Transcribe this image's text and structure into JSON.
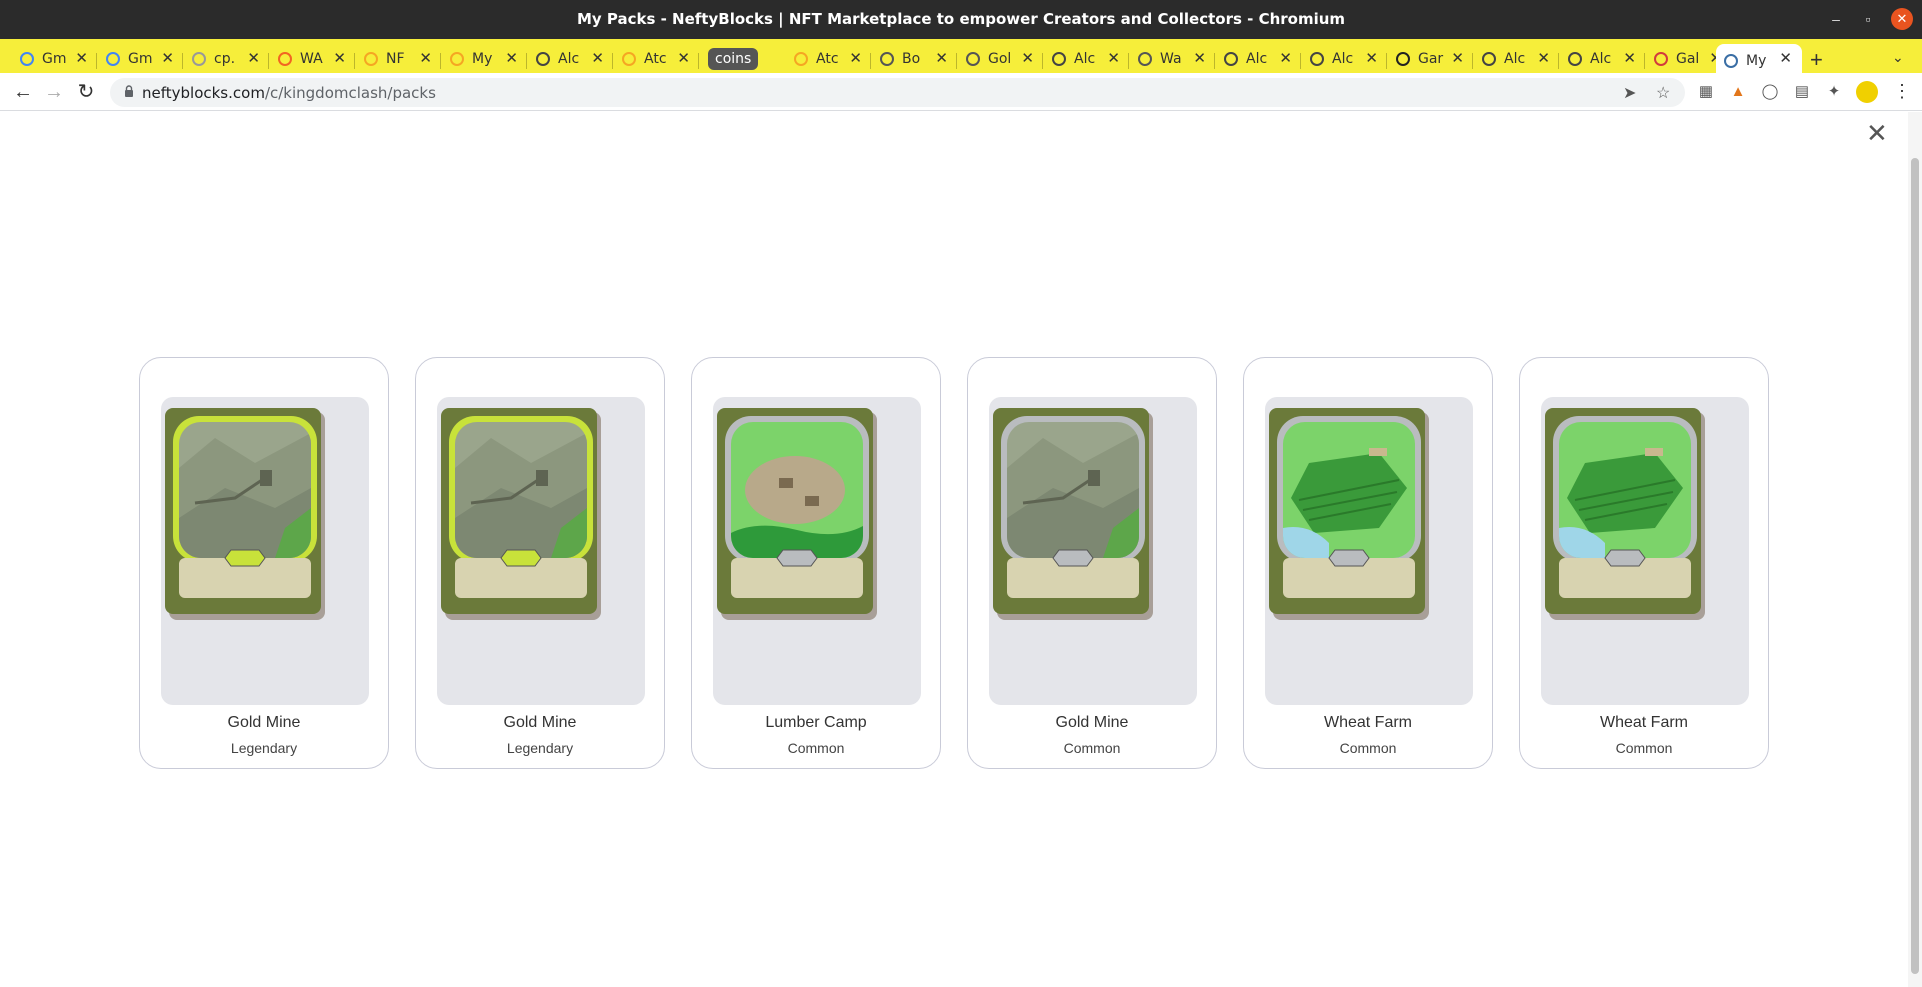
{
  "window": {
    "title": "My Packs - NeftyBlocks | NFT Marketplace to empower Creators and Collectors - Chromium"
  },
  "tabs": [
    {
      "label": "Gm",
      "icon": "google-icon",
      "color": "#4285f4"
    },
    {
      "label": "Gm",
      "icon": "google-icon",
      "color": "#4285f4"
    },
    {
      "label": "cp.",
      "icon": "loading-icon",
      "color": "#999999"
    },
    {
      "label": "WA",
      "icon": "wax-icon",
      "color": "#f26522"
    },
    {
      "label": "NF",
      "icon": "sun-icon",
      "color": "#f5a623"
    },
    {
      "label": "My",
      "icon": "sun-icon",
      "color": "#f5a623"
    },
    {
      "label": "Alc",
      "icon": "drop-icon",
      "color": "#444444"
    },
    {
      "label": "Atc",
      "icon": "sun-icon",
      "color": "#f5a623"
    },
    {
      "label": "Atc",
      "icon": "sun-icon",
      "color": "#f5a623"
    },
    {
      "label": "Bo",
      "icon": "globe-icon",
      "color": "#555555"
    },
    {
      "label": "Gol",
      "icon": "globe-icon",
      "color": "#555555"
    },
    {
      "label": "Alc",
      "icon": "drop-icon",
      "color": "#444444"
    },
    {
      "label": "Wa",
      "icon": "globe-icon",
      "color": "#555555"
    },
    {
      "label": "Alc",
      "icon": "drop-icon",
      "color": "#444444"
    },
    {
      "label": "Alc",
      "icon": "drop-icon",
      "color": "#444444"
    },
    {
      "label": "Gar",
      "icon": "game-icon",
      "color": "#222222"
    },
    {
      "label": "Alc",
      "icon": "drop-icon",
      "color": "#444444"
    },
    {
      "label": "Alc",
      "icon": "drop-icon",
      "color": "#444444"
    },
    {
      "label": "Gal",
      "icon": "flag-icon",
      "color": "#d23c3c"
    },
    {
      "label": "My",
      "icon": "cube-icon",
      "color": "#3a6ea5"
    }
  ],
  "tab_group": {
    "label": "coins"
  },
  "address": {
    "host": "neftyblocks.com",
    "path": "/c/kingdomclash/packs"
  },
  "cards": [
    {
      "name": "Gold Mine",
      "rarity": "Legendary",
      "art": "gold-mine",
      "frame": "legendary"
    },
    {
      "name": "Gold Mine",
      "rarity": "Legendary",
      "art": "gold-mine",
      "frame": "legendary"
    },
    {
      "name": "Lumber Camp",
      "rarity": "Common",
      "art": "lumber-camp",
      "frame": "common"
    },
    {
      "name": "Gold Mine",
      "rarity": "Common",
      "art": "gold-mine",
      "frame": "common"
    },
    {
      "name": "Wheat Farm",
      "rarity": "Common",
      "art": "wheat-farm",
      "frame": "common"
    },
    {
      "name": "Wheat Farm",
      "rarity": "Common",
      "art": "wheat-farm",
      "frame": "common"
    }
  ],
  "colors": {
    "tabstrip": "#f6ee3a",
    "legendary_frame": "#c8e23a",
    "common_frame": "#b9bcbf"
  }
}
